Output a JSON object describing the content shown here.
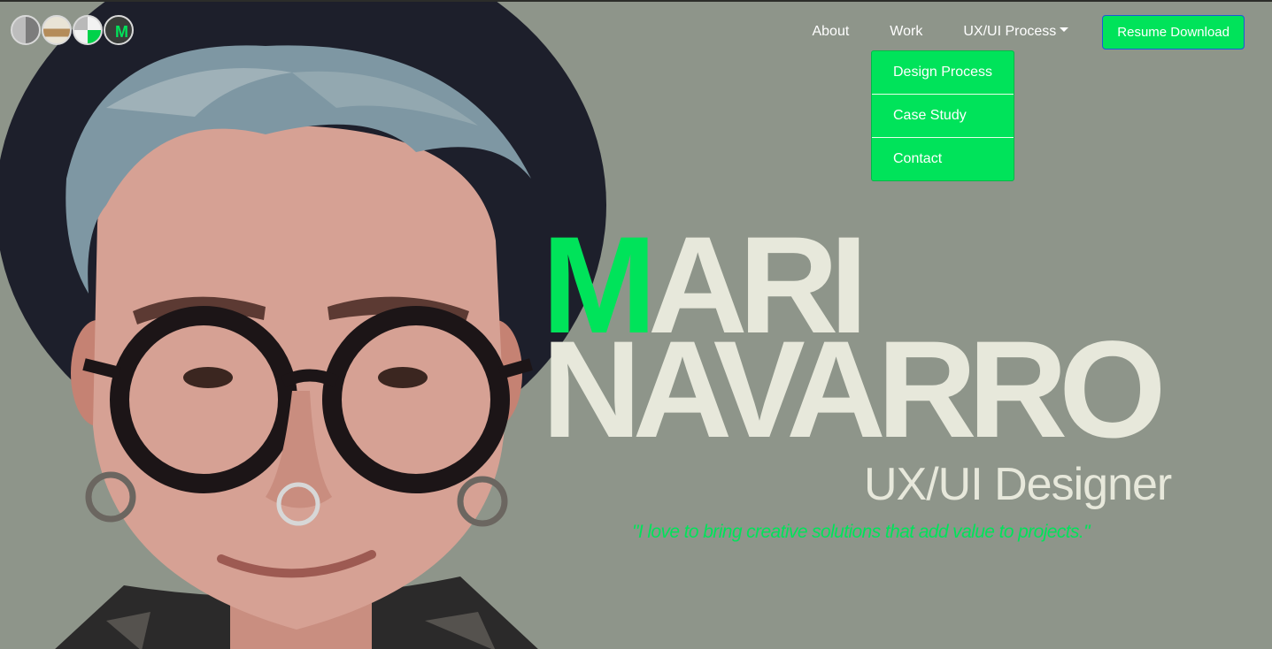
{
  "nav": {
    "logo_letter": "M",
    "links": [
      "About",
      "Work",
      "UX/UI Process"
    ],
    "resume_button": "Resume Download",
    "dropdown": [
      "Design Process",
      "Case Study",
      "Contact"
    ]
  },
  "hero": {
    "name_first_accent": "M",
    "name_first_rest": "ARI",
    "name_last": "NAVARRO",
    "role": "UX/UI Designer",
    "quote": "\"I love to bring creative solutions that add value to projects.\""
  },
  "colors": {
    "accent": "#00e35a",
    "background": "#8e958a",
    "headline": "#e7e8db"
  }
}
